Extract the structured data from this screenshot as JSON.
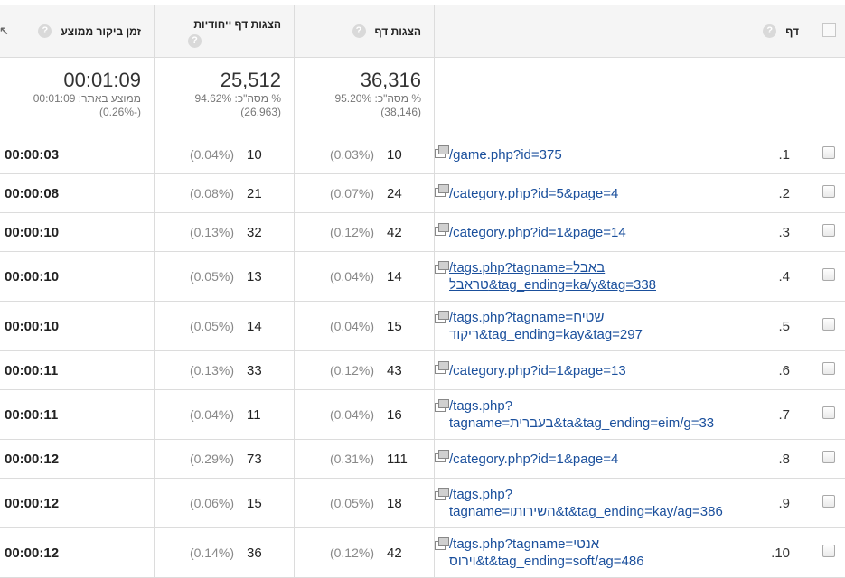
{
  "header": {
    "page_label": "דף",
    "views_label": "הצגות דף",
    "unique_label": "הצגות דף ייחודיות",
    "time_label": "זמן ביקור ממוצע",
    "help_glyph": "?",
    "sort_arrow_glyph": "↖"
  },
  "totals": {
    "views": {
      "big": "36,316",
      "line1": "% מסה\"כ: 95.20%",
      "line2": "(38,146)"
    },
    "unique": {
      "big": "25,512",
      "line1": "% מסה\"כ: 94.62%",
      "line2": "(26,963)"
    },
    "time": {
      "big": "00:01:09",
      "line1": "ממוצע באתר: 00:01:09",
      "line2": "(-0.26%)"
    }
  },
  "rows": [
    {
      "num": "1.",
      "page": "/game.php?id=375",
      "views": "10",
      "views_pct": "(0.03%)",
      "unique": "10",
      "unique_pct": "(0.04%)",
      "time": "00:00:03"
    },
    {
      "num": "2.",
      "page": "/category.php?id=5&page=4",
      "views": "24",
      "views_pct": "(0.07%)",
      "unique": "21",
      "unique_pct": "(0.08%)",
      "time": "00:00:08"
    },
    {
      "num": "3.",
      "page": "/category.php?id=1&page=14",
      "views": "42",
      "views_pct": "(0.12%)",
      "unique": "32",
      "unique_pct": "(0.13%)",
      "time": "00:00:10"
    },
    {
      "num": "4.",
      "page": "/tags.php?tagname=באבל טראבל&tag_ending=ka/y&tag=338",
      "views": "14",
      "views_pct": "(0.04%)",
      "unique": "13",
      "unique_pct": "(0.05%)",
      "time": "00:00:10"
    },
    {
      "num": "5.",
      "page": "/tags.php?tagname=שטיח ריקוד&tag_ending=kay&tag=297",
      "views": "15",
      "views_pct": "(0.04%)",
      "unique": "14",
      "unique_pct": "(0.05%)",
      "time": "00:00:10"
    },
    {
      "num": "6.",
      "page": "/category.php?id=1&page=13",
      "views": "43",
      "views_pct": "(0.12%)",
      "unique": "33",
      "unique_pct": "(0.13%)",
      "time": "00:00:11"
    },
    {
      "num": "7.",
      "page": "/tags.php?tagname=בעברית&ta&tag_ending=eim/g=33",
      "views": "16",
      "views_pct": "(0.04%)",
      "unique": "11",
      "unique_pct": "(0.04%)",
      "time": "00:00:11"
    },
    {
      "num": "8.",
      "page": "/category.php?id=1&page=4",
      "views": "111",
      "views_pct": "(0.31%)",
      "unique": "73",
      "unique_pct": "(0.29%)",
      "time": "00:00:12"
    },
    {
      "num": "9.",
      "page": "/tags.php?tagname=השירותו&t&tag_ending=kay/ag=386",
      "views": "18",
      "views_pct": "(0.05%)",
      "unique": "15",
      "unique_pct": "(0.06%)",
      "time": "00:00:12"
    },
    {
      "num": "10.",
      "page": "/tags.php?tagname=אנטי וירוס&t&tag_ending=soft/ag=486",
      "views": "42",
      "views_pct": "(0.12%)",
      "unique": "36",
      "unique_pct": "(0.14%)",
      "time": "00:00:12"
    }
  ]
}
